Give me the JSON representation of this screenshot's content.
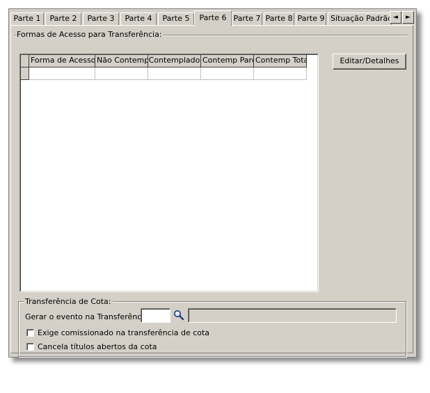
{
  "tabs": [
    "Parte 1",
    "Parte 2",
    "Parte 3",
    "Parte 4",
    "Parte 5",
    "Parte 6",
    "Parte 7",
    "Parte 8",
    "Parte 9",
    "Situação Padrão N"
  ],
  "active_tab": "Parte 6",
  "tab_scroll": {
    "left": "◄",
    "right": "►"
  },
  "access_group": {
    "title": "Formas de Acesso para Transferência:",
    "columns": [
      "Forma de Acesso",
      "Não Contemp.",
      "Contemplado",
      "Contemp Parc.",
      "Contemp Total."
    ],
    "rows": [
      [
        "",
        "",
        "",
        "",
        ""
      ]
    ]
  },
  "edit_button": "Editar/Detalhes",
  "cota_group": {
    "title": "Transferência de Cota:",
    "event_label": "Gerar o evento na Transferência:",
    "event_code": "",
    "event_description": "",
    "checkbox_commissioned": {
      "label": "Exige comissionado na transferência de cota",
      "checked": false
    },
    "checkbox_cancel": {
      "label": "Cancela títulos abertos da cota",
      "checked": false
    }
  }
}
